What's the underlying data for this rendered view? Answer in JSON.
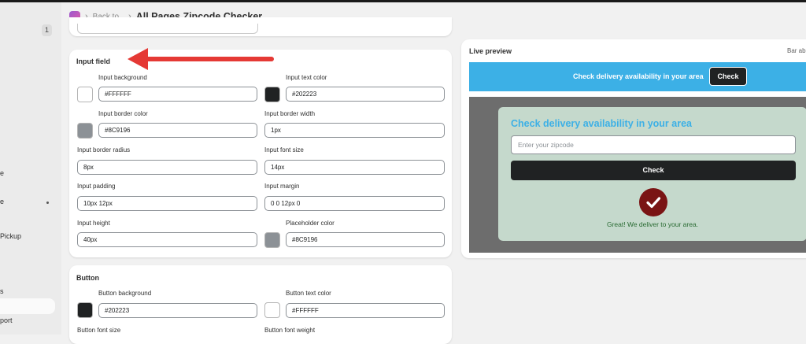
{
  "sidebar": {
    "badge": "1",
    "fragments": [
      "e",
      "e",
      "Pickup",
      "s",
      "port"
    ]
  },
  "header": {
    "back_label": "Back to",
    "title": "All Pages Zipcode Checker"
  },
  "input_field_section": {
    "title": "Input field",
    "fields": [
      {
        "label": "Input background",
        "value": "#FFFFFF",
        "swatch": "#FFFFFF"
      },
      {
        "label": "Input text color",
        "value": "#202223",
        "swatch": "#202223"
      },
      {
        "label": "Input border color",
        "value": "#8C9196",
        "swatch": "#8C9196"
      },
      {
        "label": "Input border width",
        "value": "1px"
      },
      {
        "label": "Input border radius",
        "value": "8px"
      },
      {
        "label": "Input font size",
        "value": "14px"
      },
      {
        "label": "Input padding",
        "value": "10px 12px"
      },
      {
        "label": "Input margin",
        "value": "0 0 12px 0"
      },
      {
        "label": "Input height",
        "value": "40px"
      },
      {
        "label": "Placeholder color",
        "value": "#8C9196",
        "swatch": "#8C9196"
      }
    ]
  },
  "button_section": {
    "title": "Button",
    "fields": [
      {
        "label": "Button background",
        "value": "#202223",
        "swatch": "#202223"
      },
      {
        "label": "Button text color",
        "value": "#FFFFFF",
        "swatch": "#FFFFFF"
      },
      {
        "label": "Button font size"
      },
      {
        "label": "Button font weight"
      }
    ]
  },
  "live_preview": {
    "title": "Live preview",
    "tabs_label": "Bar ab",
    "bar": {
      "text": "Check delivery availability in your area",
      "button": "Check",
      "background": "#3CB0E6"
    },
    "popup": {
      "heading": "Check delivery availability in your area",
      "placeholder": "Enter your zipcode",
      "button": "Check",
      "success_message": "Great! We deliver to your area.",
      "background": "#C5D9CC",
      "heading_color": "#3CB0E6",
      "icon": "check-circle-icon"
    }
  },
  "colors": {
    "annotation_arrow": "#E53935"
  }
}
